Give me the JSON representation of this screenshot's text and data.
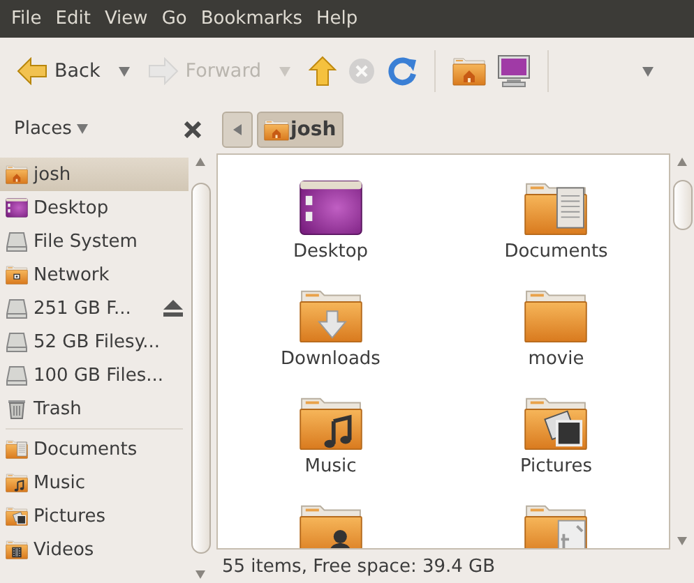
{
  "menu": [
    {
      "label": "File"
    },
    {
      "label": "Edit"
    },
    {
      "label": "View"
    },
    {
      "label": "Go"
    },
    {
      "label": "Bookmarks"
    },
    {
      "label": "Help"
    }
  ],
  "toolbar": [
    {
      "kind": "back",
      "label": "Back",
      "disabled": false
    },
    {
      "kind": "caret",
      "disabled": false
    },
    {
      "kind": "forward",
      "label": "Forward",
      "disabled": true
    },
    {
      "kind": "caret",
      "disabled": true
    },
    {
      "kind": "up",
      "disabled": false
    },
    {
      "kind": "stop",
      "disabled": true
    },
    {
      "kind": "reload",
      "disabled": false
    },
    {
      "kind": "separator"
    },
    {
      "kind": "home",
      "disabled": false
    },
    {
      "kind": "computer",
      "disabled": false
    },
    {
      "kind": "separator"
    },
    {
      "kind": "overflow",
      "disabled": false
    }
  ],
  "sidebar": {
    "header": "Places",
    "sections": [
      {
        "items": [
          {
            "label": "josh",
            "kind": "home",
            "selected": true,
            "ejectable": false
          },
          {
            "label": "Desktop",
            "kind": "desktop",
            "selected": false,
            "ejectable": false
          },
          {
            "label": "File System",
            "kind": "drive",
            "selected": false,
            "ejectable": false
          },
          {
            "label": "Network",
            "kind": "network",
            "selected": false,
            "ejectable": false
          },
          {
            "label": "251 GB F...",
            "kind": "drive",
            "selected": false,
            "ejectable": true
          },
          {
            "label": "52 GB Filesy...",
            "kind": "drive",
            "selected": false,
            "ejectable": false
          },
          {
            "label": "100 GB Files...",
            "kind": "drive",
            "selected": false,
            "ejectable": false
          },
          {
            "label": "Trash",
            "kind": "trash",
            "selected": false,
            "ejectable": false
          }
        ]
      },
      {
        "items": [
          {
            "label": "Documents",
            "kind": "documents",
            "selected": false,
            "ejectable": false
          },
          {
            "label": "Music",
            "kind": "music",
            "selected": false,
            "ejectable": false
          },
          {
            "label": "Pictures",
            "kind": "pictures",
            "selected": false,
            "ejectable": false
          },
          {
            "label": "Videos",
            "kind": "videos",
            "selected": false,
            "ejectable": false
          }
        ]
      }
    ]
  },
  "pathbar": {
    "crumbs": [
      {
        "label": "josh",
        "selected": true
      }
    ]
  },
  "files": [
    {
      "label": "Desktop",
      "kind": "desktop"
    },
    {
      "label": "Documents",
      "kind": "documents"
    },
    {
      "label": "Downloads",
      "kind": "downloads"
    },
    {
      "label": "movie",
      "kind": "folder"
    },
    {
      "label": "Music",
      "kind": "music"
    },
    {
      "label": "Pictures",
      "kind": "pictures"
    },
    {
      "kind": "person"
    },
    {
      "kind": "templates"
    }
  ],
  "status_bar": "55 items, Free space: 39.4 GB"
}
